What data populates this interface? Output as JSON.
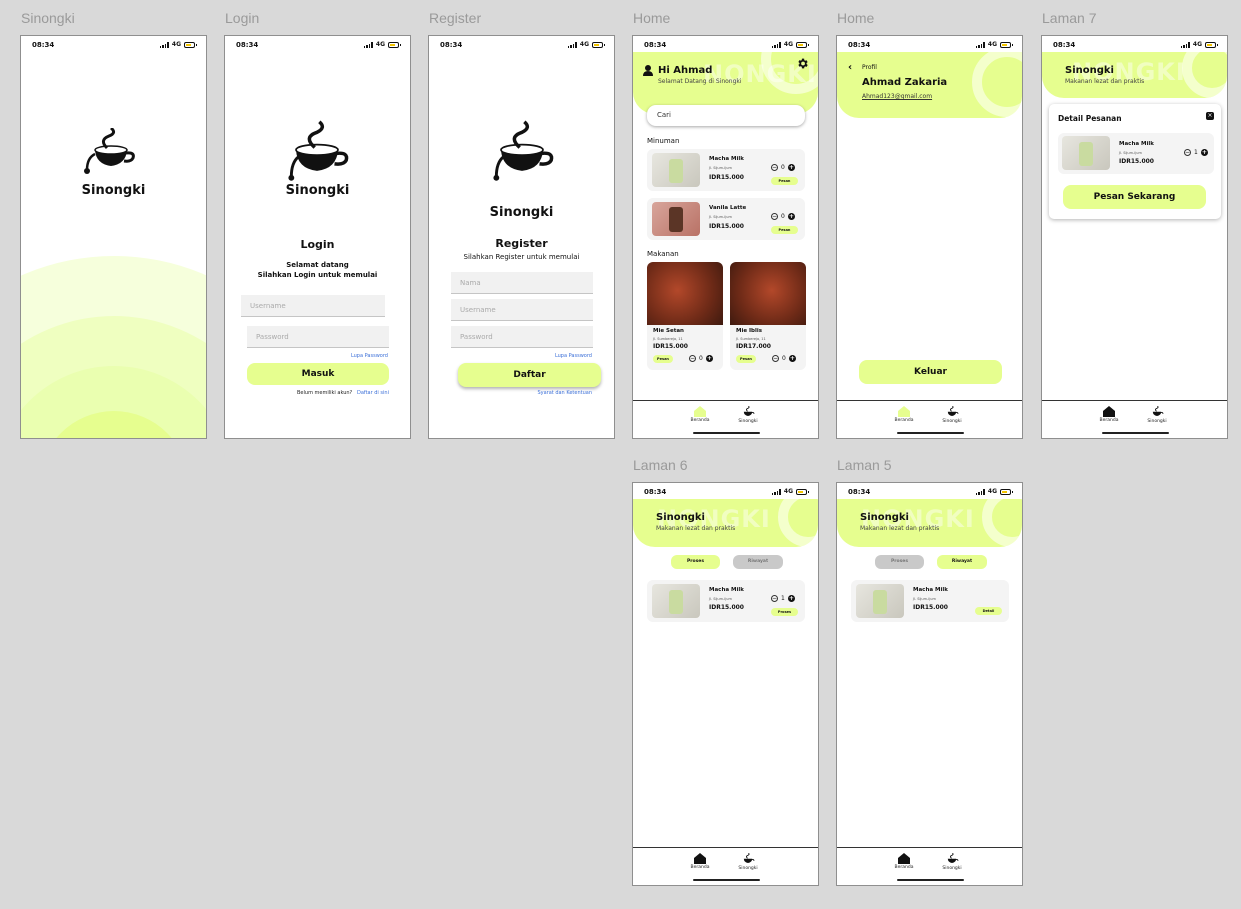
{
  "frames": {
    "splash": {
      "label": "Sinongki",
      "brand": "Sinongki"
    },
    "login": {
      "label": "Login",
      "brand": "Sinongki",
      "title": "Login",
      "welcome": "Selamat datang",
      "subtitle": "Silahkan Login untuk memulai",
      "username_placeholder": "Username",
      "password_placeholder": "Password",
      "forgot": "Lupa Password",
      "submit": "Masuk",
      "no_account": "Belum memiliki akun?",
      "register_link": "Daftar di sini"
    },
    "register": {
      "label": "Register",
      "brand": "Sinongki",
      "title": "Register",
      "subtitle": "Silahkan Register untuk memulai",
      "name_placeholder": "Nama",
      "username_placeholder": "Username",
      "password_placeholder": "Password",
      "forgot": "Lupa Password",
      "submit": "Daftar",
      "terms": "Syarat dan Ketentuan"
    },
    "home": {
      "label": "Home",
      "ghost": "NONGKI",
      "greeting": "Hi Ahmad",
      "welcome": "Selamat Datang di Sinongki",
      "search_placeholder": "Cari",
      "drinks_title": "Minuman",
      "foods_title": "Makanan",
      "drinks": [
        {
          "name": "Macha Milk",
          "sub": "Jl. Sijum-ijum",
          "price": "IDR15.000",
          "qty": "0",
          "cta": "Pesan"
        },
        {
          "name": "Vanila Latte",
          "sub": "Jl. Sijum-ijum",
          "price": "IDR15.000",
          "qty": "0",
          "cta": "Pesan"
        }
      ],
      "foods": [
        {
          "name": "Mie Setan",
          "sub": "Jl. Sumberejo, 11",
          "price": "IDR15.000",
          "qty": "0",
          "cta": "Pesan"
        },
        {
          "name": "Mie Iblis",
          "sub": "Jl. Sumberejo, 11",
          "price": "IDR17.000",
          "qty": "0",
          "cta": "Pesan"
        }
      ]
    },
    "profile": {
      "label": "Home",
      "back": "Profil",
      "name": "Ahmad Zakaria",
      "email": "Ahmad123@gmail.com",
      "logout": "Keluar"
    },
    "laman7": {
      "label": "Laman 7",
      "ghost": "NONGKI",
      "brand": "Sinongki",
      "tagline": "Makanan lezat dan praktis",
      "detail_title": "Detail Pesanan",
      "item": {
        "name": "Macha Milk",
        "sub": "Jl. Sijum-ijum",
        "price": "IDR15.000",
        "qty": "1"
      },
      "order_btn": "Pesan Sekarang"
    },
    "laman6": {
      "label": "Laman 6",
      "ghost": "NONGKI",
      "brand": "Sinongki",
      "tagline": "Makanan lezat dan praktis",
      "tab_process": "Proses",
      "tab_history": "Riwayat",
      "item": {
        "name": "Macha Milk",
        "sub": "Jl. Sijum-ijum",
        "price": "IDR15.000",
        "qty": "1",
        "cta": "Proses"
      }
    },
    "laman5": {
      "label": "Laman 5",
      "ghost": "NONGKI",
      "brand": "Sinongki",
      "tagline": "Makanan lezat dan praktis",
      "tab_process": "Proses",
      "tab_history": "Riwayat",
      "item": {
        "name": "Macha Milk",
        "sub": "Jl. Sijum-ijum",
        "price": "IDR15.000",
        "cta": "Detail"
      }
    }
  },
  "status": {
    "time": "08:34",
    "network": "4G"
  },
  "nav": {
    "home": "Beranda",
    "brand": "Sinongki"
  },
  "colors": {
    "accent": "#e6fe8f",
    "bg": "#d9d9d9",
    "link": "#3b6fd8"
  }
}
